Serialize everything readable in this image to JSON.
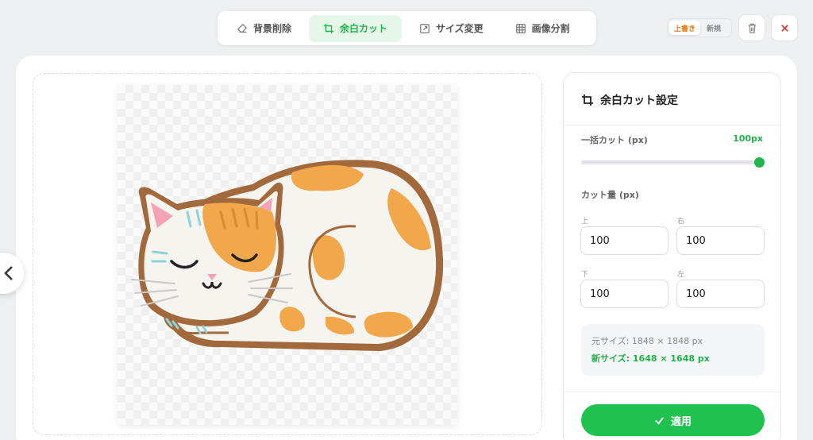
{
  "toolbar": {
    "tabs": [
      {
        "label": "背景削除",
        "icon": "eraser-icon",
        "active": false
      },
      {
        "label": "余白カット",
        "icon": "crop-icon",
        "active": true
      },
      {
        "label": "サイズ変更",
        "icon": "resize-icon",
        "active": false
      },
      {
        "label": "画像分割",
        "icon": "grid-icon",
        "active": false
      }
    ]
  },
  "mode": {
    "overwrite": "上書き",
    "new": "新規",
    "selected": "overwrite"
  },
  "settings": {
    "title": "余白カット設定",
    "bulk_label": "一括カット (px)",
    "bulk_value": "100px",
    "bulk_fraction": 1.0,
    "amount_label": "カット量 (px)",
    "fields": {
      "top": {
        "label": "上",
        "value": "100"
      },
      "right": {
        "label": "右",
        "value": "100"
      },
      "bottom": {
        "label": "下",
        "value": "100"
      },
      "left": {
        "label": "左",
        "value": "100"
      }
    },
    "orig_size": "元サイズ: 1848 × 1848 px",
    "new_size": "新サイズ: 1648 × 1648 px",
    "apply_label": "適用"
  },
  "colors": {
    "accent": "#1fb54a",
    "button": "#1fc24f",
    "danger": "#e53935",
    "warn": "#e07a14"
  }
}
